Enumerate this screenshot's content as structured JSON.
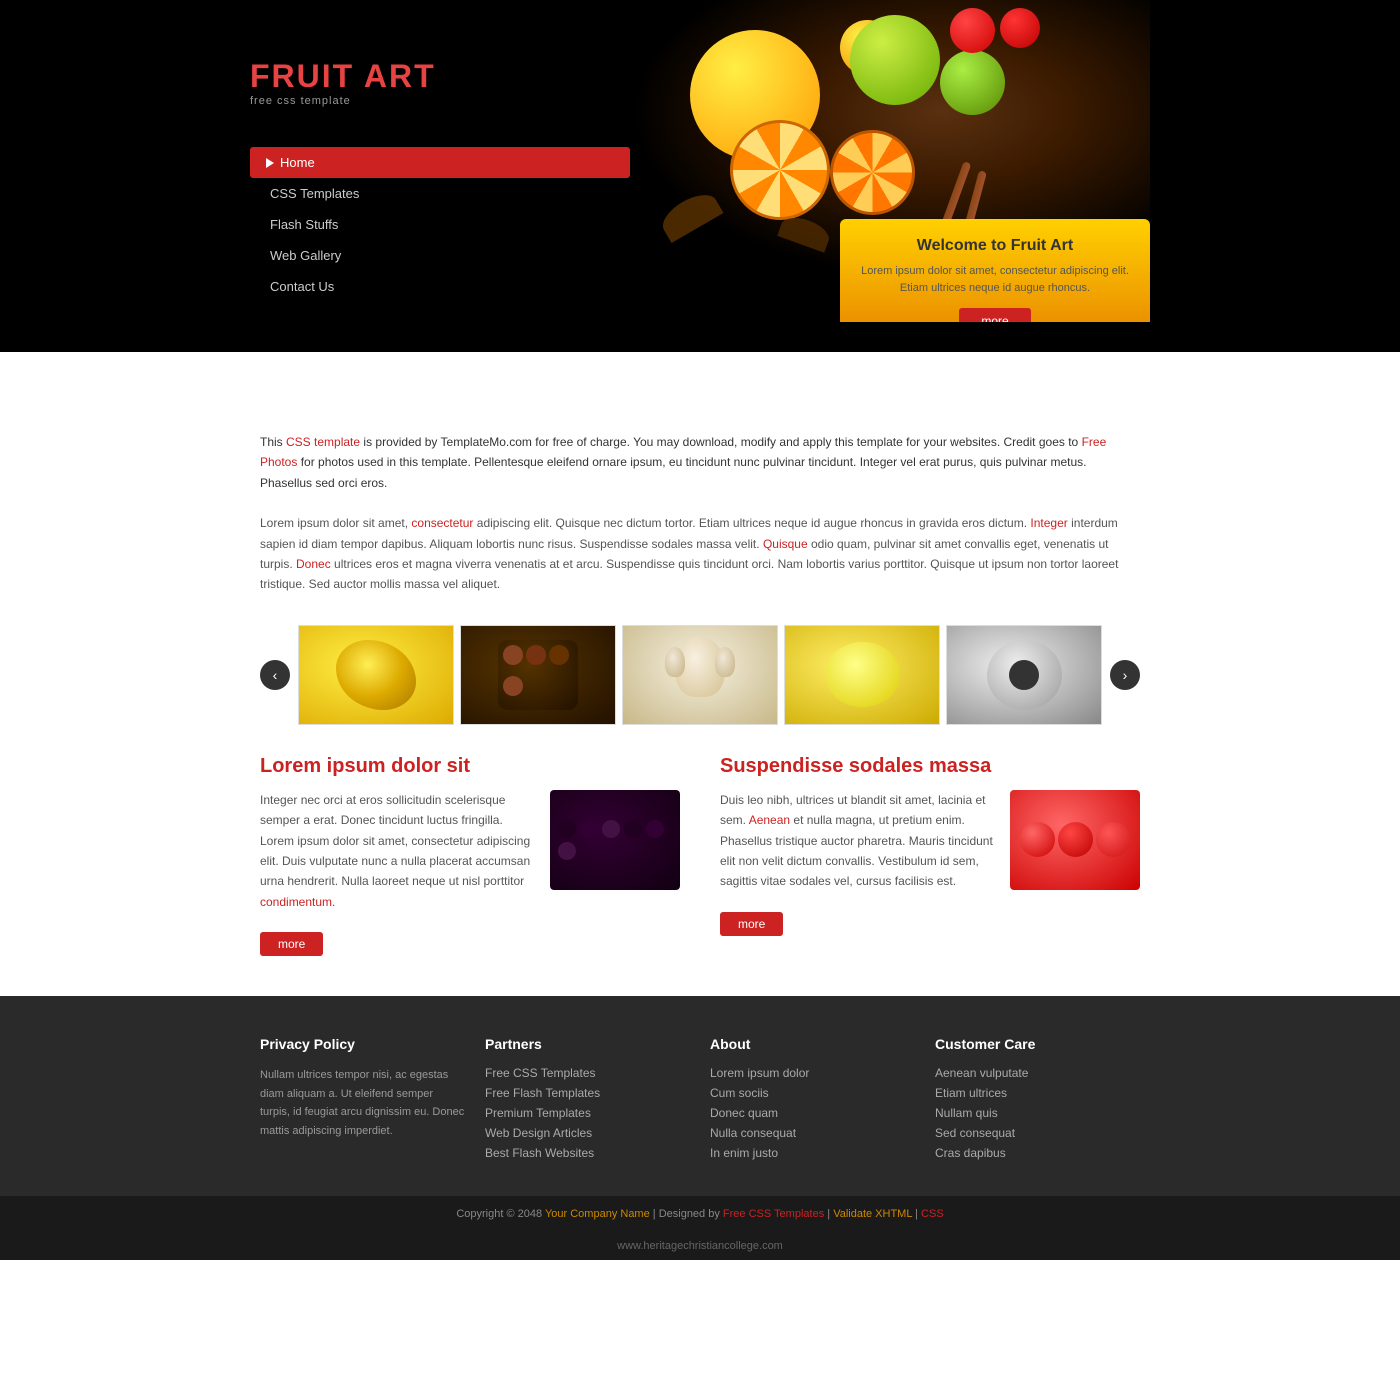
{
  "site": {
    "url": "www.heritagechristiancollege.com"
  },
  "header": {
    "logo": {
      "title_black": "FRUIT ",
      "title_red": "ART",
      "subtitle": "free css template"
    },
    "nav": {
      "items": [
        {
          "label": "Home",
          "active": true
        },
        {
          "label": "CSS Templates",
          "active": false
        },
        {
          "label": "Flash Stuffs",
          "active": false
        },
        {
          "label": "Web Gallery",
          "active": false
        },
        {
          "label": "Contact Us",
          "active": false
        }
      ]
    },
    "welcome": {
      "title": "Welcome to Fruit Art",
      "body": "Lorem ipsum dolor sit amet, consectetur adipiscing elit. Etiam ultrices neque id augue rhoncus.",
      "more_label": "more"
    }
  },
  "main": {
    "intro": {
      "text": "This CSS template is provided by TemplateMo.com for free of charge. You may download, modify and apply this template for your websites. Credit goes to Free Photos for photos used in this template. Pellentesque eleifend ornare ipsum, eu tincidunt nunc pulvinar tincidunt. Integer vel erat purus, quis pulvinar metus. Phasellus sed orci eros."
    },
    "body_paragraph": "Lorem ipsum dolor sit amet, consectetur adipiscing elit. Quisque nec dictum tortor. Etiam ultrices neque id augue rhoncus in gravida eros dictum. Integer interdum sapien id diam tempor dapibus. Aliquam lobortis nunc risus. Suspendisse sodales massa velit. Quisque odio quam, pulvinar sit amet convallis eget, venenatis ut turpis. Donec ultrices eros et magna viverra venenatis at et arcu. Suspendisse quis tincidunt orci. Nam lobortis varius porttitor. Quisque ut ipsum non tortor laoreet tristique. Sed auctor mollis massa vel aliquet.",
    "gallery": {
      "prev_label": "‹",
      "next_label": "›",
      "items": [
        {
          "alt": "mango",
          "class": "thumb-mango"
        },
        {
          "alt": "chocolate balls",
          "class": "thumb-choco"
        },
        {
          "alt": "garlic",
          "class": "thumb-garlic"
        },
        {
          "alt": "lemon",
          "class": "thumb-lemon"
        },
        {
          "alt": "coconut",
          "class": "thumb-coco"
        }
      ]
    },
    "col_left": {
      "heading": "Lorem ipsum dolor sit",
      "text": "Integer nec orci at eros sollicitudin scelerisque semper a erat. Donec tincidunt luctus fringilla. Lorem ipsum dolor sit amet, consectetur adipiscing elit. Duis vulputate nunc a nulla placerat accumsan urna hendrerit. Nulla laoreet neque ut nisl porttitor condimentum.",
      "link": "condimentum",
      "more_label": "more",
      "img_class": "img-berries"
    },
    "col_right": {
      "heading": "Suspendisse sodales massa",
      "text": "Duis leo nibh, ultrices ut blandit sit amet, lacinia et sem. Aenean et nulla magna, ut pretium enim. Phasellus tristique auctor pharetra. Mauris tincidunt elit non velit dictum convallis. Vestibulum id sem, sagittis vitae sodales vel, cursus facilisis est.",
      "link": "Aenean",
      "more_label": "more",
      "img_class": "img-tomato"
    }
  },
  "footer": {
    "cols": [
      {
        "heading": "Privacy Policy",
        "type": "text",
        "content": "Nullam ultrices tempor nisi, ac egestas diam aliquam a. Ut eleifend semper turpis, id feugiat arcu dignissim eu. Donec mattis adipiscing imperdiet."
      },
      {
        "heading": "Partners",
        "type": "links",
        "links": [
          "Free CSS Templates",
          "Free Flash Templates",
          "Premium Templates",
          "Web Design Articles",
          "Best Flash Websites"
        ]
      },
      {
        "heading": "About",
        "type": "links",
        "links": [
          "Lorem ipsum dolor",
          "Cum sociis",
          "Donec quam",
          "Nulla consequat",
          "In enim justo"
        ]
      },
      {
        "heading": "Customer Care",
        "type": "links",
        "links": [
          "Aenean vulputate",
          "Etiam ultrices",
          "Nullam quis",
          "Sed consequat",
          "Cras dapibus"
        ]
      }
    ],
    "copyright": "Copyright © 2048",
    "company": "Your Company Name",
    "designed_by": "Free CSS Templates",
    "validate1": "Validate XHTML",
    "validate2": "CSS"
  }
}
